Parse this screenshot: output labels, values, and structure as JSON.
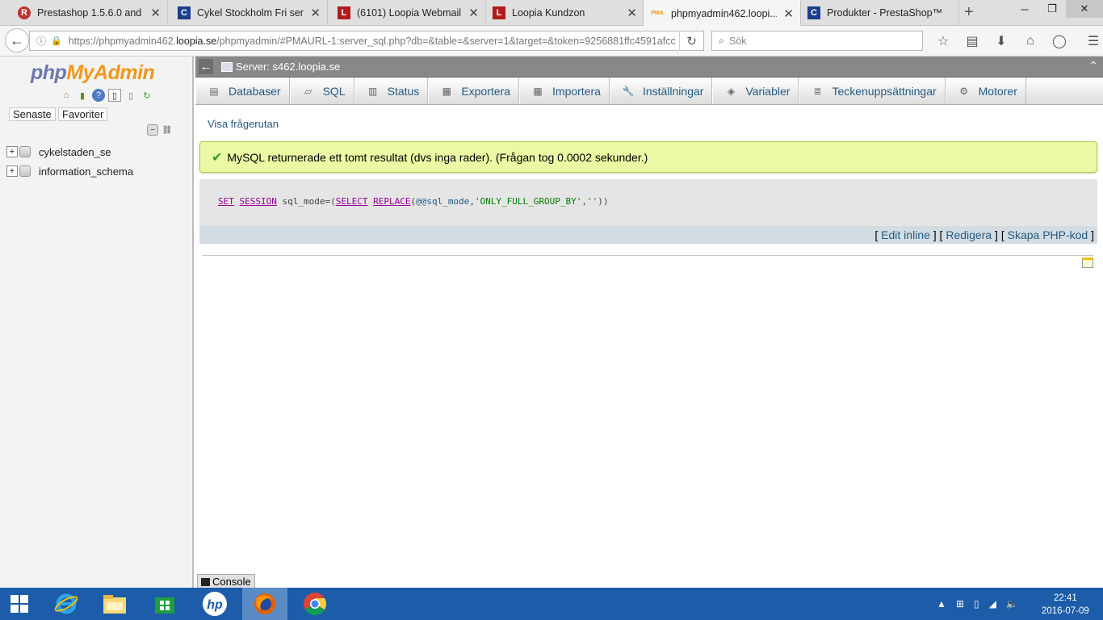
{
  "browser": {
    "tabs": [
      {
        "title": "Prestashop 1.5.6.0 and ...",
        "favicon": "R",
        "favicon_color": "#c03030"
      },
      {
        "title": "Cykel Stockholm Fri ser...",
        "favicon": "C",
        "favicon_color": "#1a3e8c"
      },
      {
        "title": "(6101) Loopia Webmail ...",
        "favicon": "L",
        "favicon_color": "#b01c1c"
      },
      {
        "title": "Loopia Kundzon",
        "favicon": "L",
        "favicon_color": "#b01c1c"
      },
      {
        "title": "phpmyadmin462.loopi...",
        "favicon": "PMA",
        "favicon_color": "#f29619"
      },
      {
        "title": "Produkter - PrestaShop™",
        "favicon": "C",
        "favicon_color": "#1a3e8c"
      }
    ],
    "new_tab": "+",
    "url_prefix": "https://phpmyadmin462.",
    "url_domain": "loopia.se",
    "url_rest": "/phpmyadmin/#PMAURL-1:server_sql.php?db=&table=&server=1&target=&token=9256881ffc4591afcc",
    "search_placeholder": "Sök"
  },
  "pma": {
    "logo_php": "php",
    "logo_myadmin": "MyAdmin",
    "recent_label": "Senaste",
    "favorites_label": "Favoriter",
    "databases": [
      "cykelstaden_se",
      "information_schema"
    ],
    "server_label": "Server: s462.loopia.se",
    "menu": [
      {
        "label": "Databaser",
        "icon": "database-icon"
      },
      {
        "label": "SQL",
        "icon": "sql-icon"
      },
      {
        "label": "Status",
        "icon": "status-icon"
      },
      {
        "label": "Exportera",
        "icon": "export-icon"
      },
      {
        "label": "Importera",
        "icon": "import-icon"
      },
      {
        "label": "Inställningar",
        "icon": "settings-icon"
      },
      {
        "label": "Variabler",
        "icon": "variables-icon"
      },
      {
        "label": "Teckenuppsättningar",
        "icon": "charset-icon"
      },
      {
        "label": "Motorer",
        "icon": "engines-icon"
      }
    ],
    "show_query_link": "Visa frågerutan",
    "success_message": "MySQL returnerade ett tomt resultat (dvs inga rader). (Frågan tog 0.0002 sekunder.)",
    "sql": {
      "kw1": "SET",
      "kw2": "SESSION",
      "plain1": "sql_mode=(",
      "fn1": "SELECT",
      "fn2": "REPLACE",
      "paren": "(",
      "var": "@@sql_mode",
      "comma1": ",",
      "str1": "'ONLY_FULL_GROUP_BY'",
      "comma2": ",",
      "str2": "''",
      "close": "))"
    },
    "links": {
      "edit_inline": "Edit inline",
      "edit": "Redigera",
      "php_code": "Skapa PHP-kod"
    },
    "console_label": "Console"
  },
  "taskbar": {
    "time": "22:41",
    "date": "2016-07-09"
  }
}
